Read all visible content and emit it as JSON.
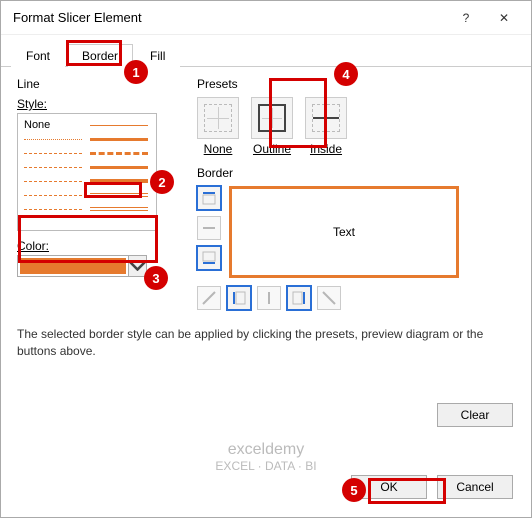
{
  "titlebar": {
    "title": "Format Slicer Element",
    "help": "?",
    "close": "✕"
  },
  "tabs": {
    "font": "Font",
    "border": "Border",
    "fill": "Fill",
    "active": "Border"
  },
  "line": {
    "section": "Line",
    "style_label": "Style:",
    "none_label": "None",
    "color_label": "Color:",
    "color_value": "#e67a2e"
  },
  "presets": {
    "section": "Presets",
    "items": [
      {
        "id": "none",
        "label": "None"
      },
      {
        "id": "outline",
        "label": "Outline"
      },
      {
        "id": "inside",
        "label": "Inside"
      }
    ]
  },
  "border": {
    "section": "Border",
    "preview_text": "Text"
  },
  "info": "The selected border style can be applied by clicking the presets, preview diagram or the buttons above.",
  "buttons": {
    "clear": "Clear",
    "ok": "OK",
    "cancel": "Cancel"
  },
  "callouts": {
    "c1": "1",
    "c2": "2",
    "c3": "3",
    "c4": "4",
    "c5": "5"
  },
  "watermark": {
    "line1": "exceldemy",
    "line2": "EXCEL · DATA · BI"
  }
}
